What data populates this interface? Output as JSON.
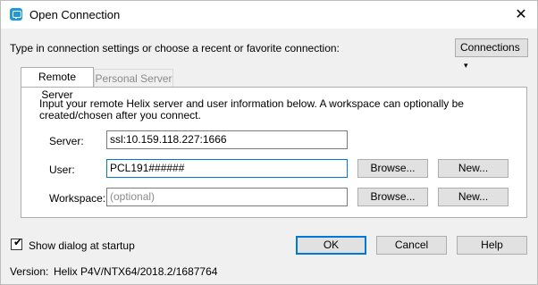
{
  "window": {
    "title": "Open Connection"
  },
  "intro": "Type in connection settings or choose a recent or favorite connection:",
  "connections_button": {
    "label": "Connections",
    "caret": "▾"
  },
  "tabs": [
    {
      "label": "Remote Server",
      "active": true
    },
    {
      "label": "Personal Server",
      "active": false
    }
  ],
  "panel": {
    "description": "Input your remote Helix server and user information below. A workspace can optionally be created/chosen after you connect.",
    "server": {
      "label": "Server:",
      "value": "ssl:10.159.118.227:1666"
    },
    "user": {
      "label": "User:",
      "value": "PCL191######"
    },
    "workspace": {
      "label": "Workspace:",
      "placeholder": "(optional)",
      "value": ""
    },
    "browse_label": "Browse...",
    "new_label": "New..."
  },
  "show_dialog": {
    "label": "Show dialog at startup",
    "checked": true
  },
  "buttons": {
    "ok": "OK",
    "cancel": "Cancel",
    "help": "Help"
  },
  "version": {
    "label": "Version:",
    "value": "Helix P4V/NTX64/2018.2/1687764"
  },
  "colors": {
    "accent": "#0078d7",
    "app_icon": "#1f9ad6"
  },
  "icons": {
    "app": "helix-app-icon",
    "close": "close-icon",
    "check": "checkmark-icon"
  }
}
